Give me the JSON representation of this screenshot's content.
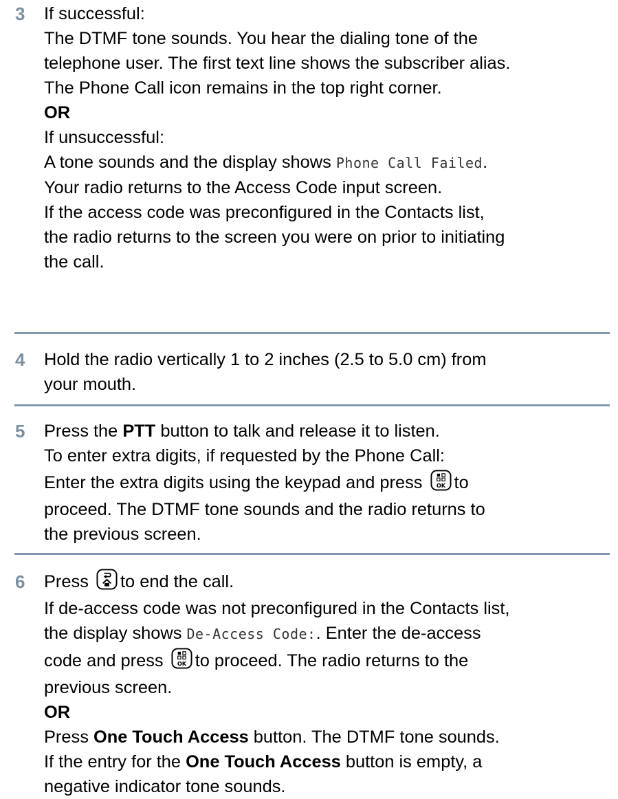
{
  "steps": [
    {
      "number": "3",
      "lines": [
        "If successful:",
        "The DTMF tone sounds. You hear the dialing tone of the",
        "telephone user. The first text line shows the subscriber alias.",
        "The Phone Call icon remains in the top right corner.",
        "OR",
        "If unsuccessful:",
        "A tone sounds and the display shows ",
        "Phone Call Failed",
        ".",
        "Your radio returns to the Access Code input screen.",
        "If the access code was preconfigured in the Contacts list,",
        "the radio returns to the screen you were on prior to initiating",
        "the call."
      ]
    },
    {
      "number": "4",
      "lines": [
        "Hold the radio vertically 1 to 2 inches (2.5 to 5.0 cm) from",
        "your mouth."
      ]
    },
    {
      "number": "5",
      "lines": [
        "Press the ",
        "PTT",
        " button to talk and release it to listen.",
        "To enter extra digits, if requested by the Phone Call:",
        "Enter the extra digits using the keypad and press",
        "to",
        "proceed. The DTMF tone sounds and the radio returns to",
        "the previous screen."
      ]
    },
    {
      "number": "6",
      "lines": [
        "Press",
        "to end the call.",
        "If de-access code was not preconfigured in the Contacts list,",
        "the display shows ",
        "De-Access Code:",
        ". Enter the de-access",
        "code and press",
        "to proceed. The radio returns to the",
        "previous screen.",
        "OR",
        "Press ",
        "One Touch Access",
        " button. The DTMF tone sounds.",
        "If the entry for the ",
        "One Touch Access",
        " button is empty, a",
        "negative indicator tone sounds."
      ]
    }
  ],
  "icons": {
    "menu_ok": "menu-ok-key-icon",
    "back_home": "back-home-key-icon"
  },
  "colors": {
    "step_number": "#7b8fa3",
    "divider": "#8297ad"
  }
}
